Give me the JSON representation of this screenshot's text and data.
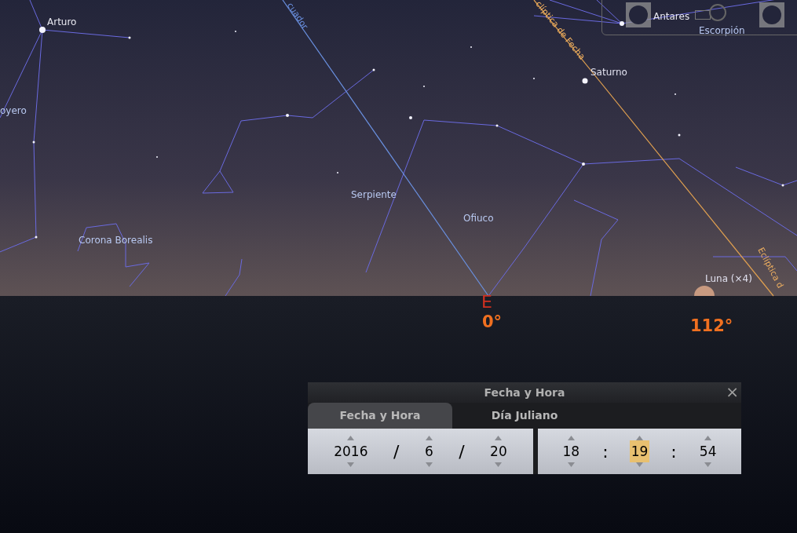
{
  "sky": {
    "labels": [
      {
        "text": "Arturo",
        "kind": "star"
      },
      {
        "text": "oyero",
        "kind": "constellation"
      },
      {
        "text": "cuador",
        "kind": "equator"
      },
      {
        "text": "clíptica de Fecha",
        "kind": "ecliptic"
      },
      {
        "text": "Saturno",
        "kind": "planet"
      },
      {
        "text": "Serpiente",
        "kind": "constellation"
      },
      {
        "text": "Ofiuco",
        "kind": "constellation"
      },
      {
        "text": "Corona Borealis",
        "kind": "constellation"
      },
      {
        "text": "Eclíptica d",
        "kind": "ecliptic"
      },
      {
        "text": "Luna (×4)",
        "kind": "planet"
      },
      {
        "text": "Antares",
        "kind": "star"
      },
      {
        "text": "Escorpión",
        "kind": "constellation"
      }
    ],
    "cardinal": "E",
    "azimuths": [
      "0°",
      "112°"
    ]
  },
  "dialog": {
    "title": "Fecha y Hora",
    "close": "×",
    "tabs": [
      {
        "label": "Fecha y Hora",
        "selected": true
      },
      {
        "label": "Día Juliano",
        "selected": false
      }
    ],
    "date": [
      {
        "kind": "field",
        "value": "2016",
        "selected": false
      },
      {
        "kind": "separator",
        "value": "/"
      },
      {
        "kind": "field",
        "value": "6",
        "selected": false
      },
      {
        "kind": "separator",
        "value": "/"
      },
      {
        "kind": "field",
        "value": "20",
        "selected": false
      }
    ],
    "time": [
      {
        "kind": "field",
        "value": "18",
        "selected": false
      },
      {
        "kind": "separator",
        "value": ":"
      },
      {
        "kind": "field",
        "value": "19",
        "selected": true
      },
      {
        "kind": "separator",
        "value": ":"
      },
      {
        "kind": "field",
        "value": "54",
        "selected": false
      }
    ]
  }
}
